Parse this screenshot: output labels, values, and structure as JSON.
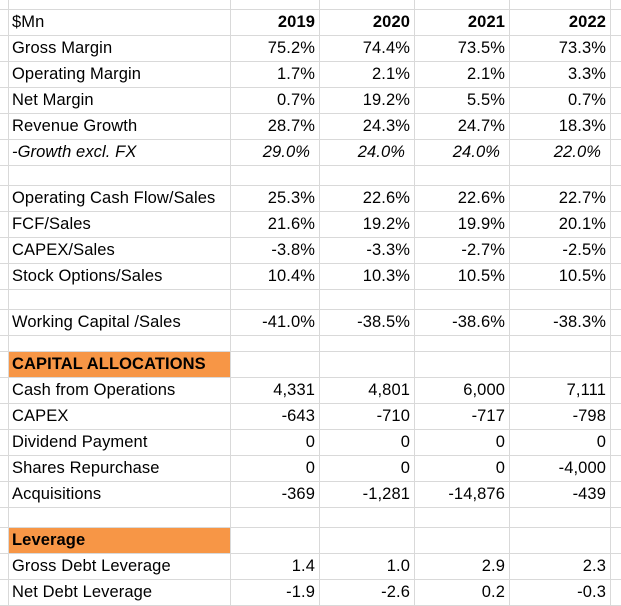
{
  "header": {
    "unit_label": "$Mn",
    "years": [
      "2019",
      "2020",
      "2021",
      "2022"
    ]
  },
  "sections": {
    "margins": [
      {
        "label": "Gross Margin",
        "values": [
          "75.2%",
          "74.4%",
          "73.5%",
          "73.3%"
        ]
      },
      {
        "label": "Operating Margin",
        "values": [
          "1.7%",
          "2.1%",
          "2.1%",
          "3.3%"
        ]
      },
      {
        "label": "Net Margin",
        "values": [
          "0.7%",
          "19.2%",
          "5.5%",
          "0.7%"
        ]
      },
      {
        "label": "Revenue Growth",
        "values": [
          "28.7%",
          "24.3%",
          "24.7%",
          "18.3%"
        ]
      },
      {
        "label": "-Growth excl. FX",
        "values": [
          "29.0%",
          "24.0%",
          "24.0%",
          "22.0%"
        ]
      }
    ],
    "cash_ratios": [
      {
        "label": "Operating Cash Flow/Sales",
        "values": [
          "25.3%",
          "22.6%",
          "22.6%",
          "22.7%"
        ]
      },
      {
        "label": "FCF/Sales",
        "values": [
          "21.6%",
          "19.2%",
          "19.9%",
          "20.1%"
        ]
      },
      {
        "label": "CAPEX/Sales",
        "values": [
          "-3.8%",
          "-3.3%",
          "-2.7%",
          "-2.5%"
        ]
      },
      {
        "label": "Stock Options/Sales",
        "values": [
          "10.4%",
          "10.3%",
          "10.5%",
          "10.5%"
        ]
      }
    ],
    "working_capital": {
      "label": "Working Capital /Sales",
      "values": [
        "-41.0%",
        "-38.5%",
        "-38.6%",
        "-38.3%"
      ]
    },
    "capital_allocations": {
      "title": "CAPITAL ALLOCATIONS",
      "rows": [
        {
          "label": "Cash from Operations",
          "values": [
            "4,331",
            "4,801",
            "6,000",
            "7,111"
          ]
        },
        {
          "label": "CAPEX",
          "values": [
            "-643",
            "-710",
            "-717",
            "-798"
          ]
        },
        {
          "label": "Dividend Payment",
          "values": [
            "0",
            "0",
            "0",
            "0"
          ]
        },
        {
          "label": "Shares Repurchase",
          "values": [
            "0",
            "0",
            "0",
            "-4,000"
          ]
        },
        {
          "label": "Acquisitions",
          "values": [
            "-369",
            "-1,281",
            "-14,876",
            "-439"
          ]
        }
      ]
    },
    "leverage": {
      "title": "Leverage",
      "rows": [
        {
          "label": "Gross Debt Leverage",
          "values": [
            "1.4",
            "1.0",
            "2.9",
            "2.3"
          ]
        },
        {
          "label": "Net Debt Leverage",
          "values": [
            "-1.9",
            "-2.6",
            "0.2",
            "-0.3"
          ]
        }
      ]
    }
  },
  "colors": {
    "section_header_fill": "#f79646",
    "gridline": "#d9d9d9"
  }
}
